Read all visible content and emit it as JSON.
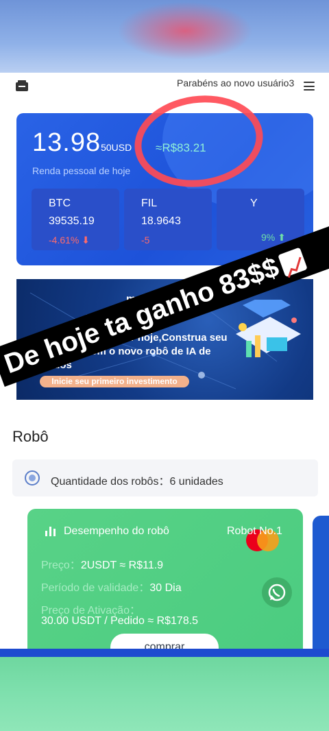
{
  "header": {
    "marquee": "Parabéns ao novo usuário3"
  },
  "earnings": {
    "amount_main": "13.98",
    "amount_suffix": "50USD",
    "brl": "≈R$83.21",
    "subtitle": "Renda pessoal de hoje"
  },
  "coins": [
    {
      "symbol": "BTC",
      "price": "39535.19",
      "change": "-4.61% ⬇"
    },
    {
      "symbol": "FIL",
      "price": "18.9643",
      "change": "-5"
    },
    {
      "symbol": "Y",
      "price": "",
      "change": "9% ⬆"
    }
  ],
  "banner": {
    "title": "mento",
    "title2": "tis",
    "desc": "Comece a negociar hoje,Construa seu portfólio com o novo robô de IA de Dados",
    "cta": "Inicie seu primeiro investimento"
  },
  "robots": {
    "section_title": "Robô",
    "count_label": "Quantidade dos robôs：",
    "count_value": "6 unidades"
  },
  "robot_card": {
    "performance_label": "Desempenho do robô",
    "robot_name": "Robot No.1",
    "price_label": "Preço：",
    "price_value": "2USDT ≈ R$11.9",
    "validity_label": "Período de validade：",
    "validity_value": "30 Dia",
    "activation_label": "Preço de Ativação：",
    "activation_value": "30.00 USDT / Pedido ≈ R$178.5",
    "buy_label": "comprar"
  },
  "overlay": {
    "text": "De hoje ta ganho 83$$"
  },
  "colors": {
    "primary_blue": "#1d52d9",
    "robot_green": "#4bcc80",
    "up_green": "#8ff0d8",
    "down_red": "#ff6b6b",
    "circle_red": "#ff4b55"
  }
}
